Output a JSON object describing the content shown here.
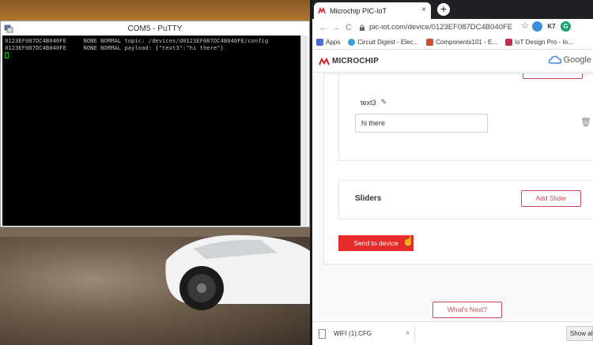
{
  "putty": {
    "title": "COM5 - PuTTY",
    "lines": [
      "0123EF087DC4B040FE     NONE NORMAL topic: /devices/d0123EF087DC4B040FE/config",
      "0123EF087DC4B040FE     NONE NORMAL payload: {\"text3\":\"hi there\"}"
    ]
  },
  "browser": {
    "tab_title": "Microchip PIC-IoT",
    "tab_close": "×",
    "new_tab": "+",
    "back": "←",
    "forward": "→",
    "reload": "C",
    "url": "pic-iot.com/device/0123EF087DC4B040FE",
    "star": "☆",
    "bookmarks": [
      {
        "label": "Apps",
        "color": "#4a6fd0"
      },
      {
        "label": "Circuit Digest - Elec...",
        "color": "#3aa0d8"
      },
      {
        "label": "Components101 - E...",
        "color": "#d04a3a"
      },
      {
        "label": "IoT Design Pro - Io...",
        "color": "#c0304a"
      }
    ],
    "extensions": [
      {
        "label": "K7",
        "color": "#333"
      },
      {
        "label": "G",
        "color": "#1aa36b"
      }
    ]
  },
  "site": {
    "brand": "MICROCHIP",
    "google": "Google"
  },
  "device": {
    "field_label": "text3",
    "field_value": "hi there",
    "sliders_title": "Sliders",
    "add_slider": "Add Slider",
    "send_button": "Send to device",
    "whats_next": "What's Next?"
  },
  "downloads": {
    "file": "WIFI (1).CFG",
    "show_all": "Show all"
  },
  "colors": {
    "accent": "#c94a5a",
    "send": "#e62b2b"
  }
}
